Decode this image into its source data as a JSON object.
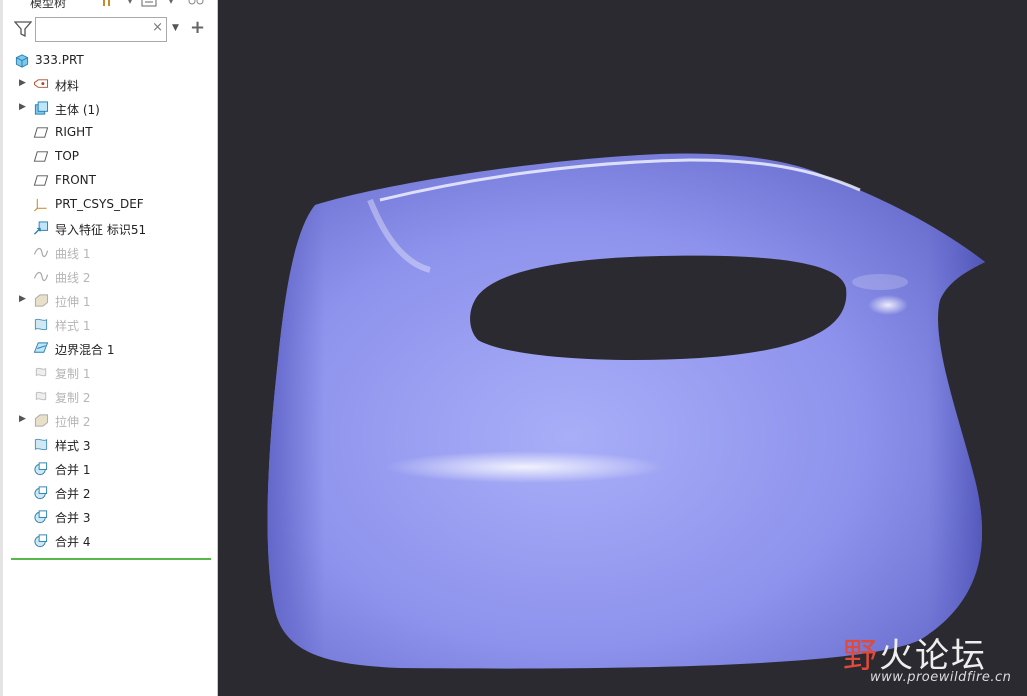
{
  "panel": {
    "title": "模型树",
    "search": {
      "value": "",
      "placeholder": ""
    }
  },
  "tree": {
    "root": "333.PRT",
    "items": [
      {
        "label": "材料",
        "expand": true,
        "icon": "material-icon",
        "dim": false
      },
      {
        "label": "主体 (1)",
        "expand": true,
        "icon": "body-icon",
        "dim": false
      },
      {
        "label": "RIGHT",
        "expand": false,
        "icon": "datum-plane-icon",
        "dim": false
      },
      {
        "label": "TOP",
        "expand": false,
        "icon": "datum-plane-icon",
        "dim": false
      },
      {
        "label": "FRONT",
        "expand": false,
        "icon": "datum-plane-icon",
        "dim": false
      },
      {
        "label": "PRT_CSYS_DEF",
        "expand": false,
        "icon": "csys-icon",
        "dim": false
      },
      {
        "label": "导入特征 标识51",
        "expand": false,
        "icon": "import-feature-icon",
        "dim": false
      },
      {
        "label": "曲线 1",
        "expand": false,
        "icon": "curve-icon",
        "dim": true
      },
      {
        "label": "曲线 2",
        "expand": false,
        "icon": "curve-icon",
        "dim": true
      },
      {
        "label": "拉伸 1",
        "expand": true,
        "icon": "extrude-icon",
        "dim": true
      },
      {
        "label": "样式 1",
        "expand": false,
        "icon": "style-icon",
        "dim": true
      },
      {
        "label": "边界混合 1",
        "expand": false,
        "icon": "boundary-blend-icon",
        "dim": false
      },
      {
        "label": "复制 1",
        "expand": false,
        "icon": "copy-icon",
        "dim": true
      },
      {
        "label": "复制 2",
        "expand": false,
        "icon": "copy-icon",
        "dim": true
      },
      {
        "label": "拉伸 2",
        "expand": true,
        "icon": "extrude-icon",
        "dim": true
      },
      {
        "label": "样式 3",
        "expand": false,
        "icon": "style-icon",
        "dim": false
      },
      {
        "label": "合并 1",
        "expand": false,
        "icon": "merge-icon",
        "dim": false
      },
      {
        "label": "合并 2",
        "expand": false,
        "icon": "merge-icon",
        "dim": false
      },
      {
        "label": "合并 3",
        "expand": false,
        "icon": "merge-icon",
        "dim": false
      },
      {
        "label": "合并 4",
        "expand": false,
        "icon": "merge-icon",
        "dim": false
      }
    ]
  },
  "watermark": {
    "title_first": "野",
    "title_rest": "火论坛",
    "url": "www.proewildfire.cn"
  },
  "colors": {
    "viewport_bg": "#2b2a30",
    "model": "#8f95ee",
    "insert_line": "#58b84a"
  }
}
